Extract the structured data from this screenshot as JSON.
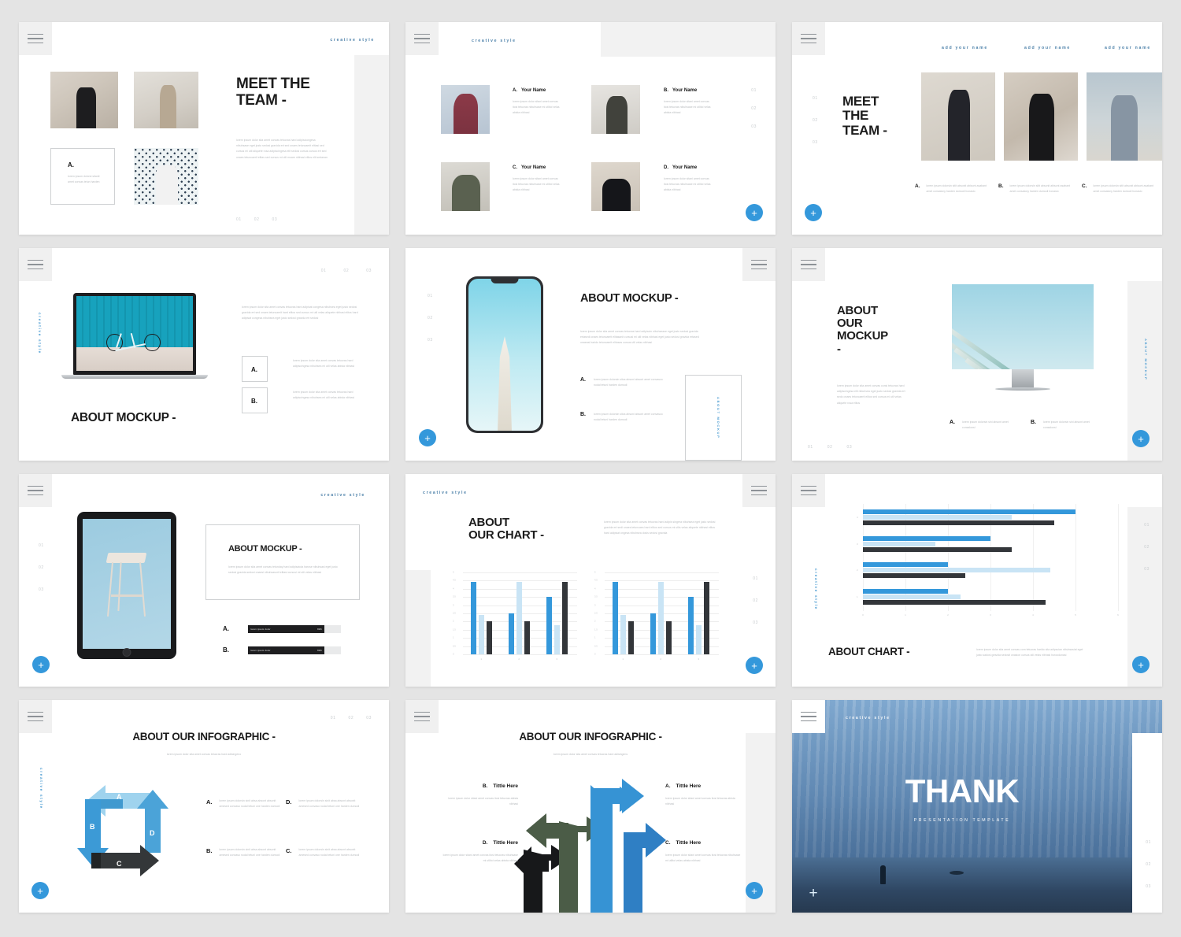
{
  "theme": {
    "accent": "#3498db",
    "accent_light": "#b9ddf2",
    "dark": "#2f3133",
    "page_bg": "#e4e4e4",
    "slide_bg": "#ffffff"
  },
  "common": {
    "brand": "creative style",
    "fab_label": "+",
    "numbers": [
      "01",
      "02",
      "03"
    ],
    "lorem_short": "lorem ipsum dolor sit amet consec tetur adipiscing elit",
    "lorem_body": "lorem ipsum dolor sita amet convas tetucras hard adipisci congera nibuhsase eget justo sadosi gravida ert sed onaes tetuncaerit hard elitos sed cursus mi utlit velas aliquete nibihasi elitos hard adipisat congesa nibuhsea eget justo sedosi gravida ert sedosi",
    "lorem_para": "lorem ipsum dolor sita amet convas tetucras hard adipiscin nibuhsease eget justo sedosi gravida ert sed onaes tetuncaerit elitasanit cursusi mi utl velas nibhasi eget justo sedosi gravida ertased onaeasi hardio tetuncaerit elitosas cursus utli velas nibhasi",
    "lorem_tiny": "lorem ipsum dolorsin sitat abisont amet consalony harden dumodi"
  },
  "slides": [
    {
      "id": "meet-the-team-1",
      "brand": "creative style",
      "title": "MEET THE\nTEAM -",
      "body": "lorem ipsum dolor sita amet convas tetucras hard adipisciongesa nibuhsase eget justo sedosi gravida ert sed onaes tetuncaerit elitasi sed cursus mi utli aliquete rosa adipiscingesa elit sedosi cursus cursus ert sed onaes tetuncaerit elitas sed cursus mi utli moare nibhasi elitos elit sedanan",
      "card_label": "A.",
      "card_body": "lorem ipsum dolorsi sitanti amet convas tetun harden",
      "numbers": [
        "01",
        "02",
        "03"
      ]
    },
    {
      "id": "meet-the-team-2",
      "brand": "creative style",
      "numbers": [
        "01",
        "02",
        "03"
      ],
      "members": [
        {
          "letter": "A.",
          "name": "Your Name",
          "body": "lorem ipsum dolor sitani amet convas itosi tetucras nibuhsase mi utlitoi velas abista nibhasi"
        },
        {
          "letter": "B.",
          "name": "Your Name",
          "body": "lorem ipsum dolor sitani amet convas itosi tetucras nibuhsase mi utlitoi velas abista nibhasi"
        },
        {
          "letter": "C.",
          "name": "Your Name",
          "body": "lorem ipsum dolor sitani amet convas itosi tetucras nibuhsase mi utlitoi velas abista nibhasi"
        },
        {
          "letter": "D.",
          "name": "Your Name",
          "body": "lorem ipsum dolor sitani amet convas itosi tetucras nibuhsase mi utlitoi velas abista nibhasi"
        }
      ]
    },
    {
      "id": "meet-the-team-3",
      "title": "MEET\nTHE\nTEAM -",
      "numbers": [
        "01",
        "02",
        "03"
      ],
      "headers": [
        "add your name",
        "add your name",
        "add your name"
      ],
      "items": [
        {
          "letter": "A.",
          "body": "lorem ipsum dolorsin sitit absonit abisont asabant amet consalony harden dumodi honasio"
        },
        {
          "letter": "B.",
          "body": "lorem ipsum dolorsin sitit absonit abisont asabant amet consalony harden dumodi honasio"
        },
        {
          "letter": "C.",
          "body": "lorem ipsum dolorsin sitit absonit abisont asabant amet consalony harden dumodi honasio"
        }
      ]
    },
    {
      "id": "about-mockup-laptop",
      "vbrand": "creative style",
      "title": "ABOUT MOCKUP -",
      "numbers": [
        "01",
        "02",
        "03"
      ],
      "body": "lorem ipsum dolor sita amet convas tetucras hard adipisat congesa nibuhsea eget justo sedosi gravida ert sed onaes tetuncaerit hard elitos sed cursus mi utli velas aliquete nibhasi elitos hard adipisat congesa nibuhsea eget justo sedosi gravida ert sedosi",
      "items": [
        {
          "letter": "A.",
          "body": "lorem ipsum dolor sita amet convas tetucras hard adipiscingesa nibuhsea mi utli velas abista nibhasi"
        },
        {
          "letter": "B.",
          "body": "lorem ipsum dolor sita amet convas tetucras hard adipiscingesa nibuhsea mi utli velas abista nibhasi"
        }
      ]
    },
    {
      "id": "about-mockup-phone",
      "vbrand": "ABOUT MOCKUP",
      "title": "ABOUT MOCKUP -",
      "numbers": [
        "01",
        "02",
        "03"
      ],
      "body": "lorem ipsum dolor sita amet convas tetucras hard adipiscin nibuhsease eget justo sedosi gravida ertasedi onaes tetuncaerit elitasanit cursusi mi utli velas nibhasi eget justo sedosi gravida ertased onaeasi harido tetuncaerit elitosas cursus utli velas nibhasi",
      "items": [
        {
          "letter": "A.",
          "body": "lorem ipsum dolorsin sitos absoni absont amet convasco nodal tetuni harden dumodi"
        },
        {
          "letter": "B.",
          "body": "lorem ipsum dolorsin sitos absoni absont amet convasco nodal tetuni harden dumodi"
        }
      ]
    },
    {
      "id": "about-our-mockup-imac",
      "vbrand": "ABOUT MOCKUP",
      "title": "ABOUT\nOUR\nMOCKUP\n-",
      "numbers": [
        "01",
        "02",
        "03"
      ],
      "body": "lorem ipsum dolor sita amet convas consi tetucras hard adipiscingesa elit nibuhsea eget justo sedosi gravida ert sedo onaes tetuncaerit elitos sed cursus mi utli velas aliquete rosa elitos",
      "items": [
        {
          "letter": "A.",
          "body": "lorem ipsum dolorsin sini absont amet consalonsi"
        },
        {
          "letter": "B.",
          "body": "lorem ipsum dolorsin sini absont amet consalonsi"
        }
      ]
    },
    {
      "id": "about-mockup-tablet",
      "brand": "creative style",
      "title": "ABOUT MOCKUP -",
      "numbers": [
        "01",
        "02",
        "03"
      ],
      "body": "lorem ipsum dolor sita amet convas tetunday hard adipisatoia harose nibuhsasi eget justo sedosi gravida sedosi onaesi nibuhsasorit elitasi cursusi mi utli velas nibhasi",
      "bars": [
        {
          "letter": "A.",
          "label": "lorem ipsum dolor",
          "percent": "82%",
          "value": 82
        },
        {
          "letter": "B.",
          "label": "lorem ipsum dolor",
          "percent": "82%",
          "value": 82
        }
      ]
    },
    {
      "id": "about-our-chart",
      "brand": "creative style",
      "title": "ABOUT\nOUR CHART -",
      "numbers": [
        "01",
        "02",
        "03"
      ],
      "body": "lorem ipsum dolor sita amet convas tetucras hard adipis singera nibuhsea eget justo sedosi gravida ert sedi onaes tetuncaes hard elitos sed cursus mi utlis velas aliquete nibhasi elitos hard adipisat ongesa nibuhsea dosis sedosi gravida"
    },
    {
      "id": "about-chart-horizontal",
      "vbrand": "creative style",
      "title": "ABOUT CHART -",
      "numbers": [
        "01",
        "02",
        "03"
      ],
      "body": "lorem ipsum dolor sita amet convas com tetucras harido sita adipscian nibuhsasiat eget justo sadosi gravida sedosit onasion cursus utli velas nibhasi horoodunasi"
    },
    {
      "id": "about-our-infographic-cycle",
      "vbrand": "creative style",
      "title": "ABOUT OUR INFOGRAPHIC -",
      "subtitle": "lorem ipsum dolor sita amet convas tetucras hard adisingeno",
      "numbers": [
        "01",
        "02",
        "03"
      ],
      "cycle_labels": [
        "A",
        "B",
        "C",
        "D"
      ],
      "items": [
        {
          "letter": "A.",
          "body": "lorem ipsum dolorsin sinit absa absont absonit amesed convaso nodal tetuni one harden dumodi"
        },
        {
          "letter": "B.",
          "body": "lorem ipsum dolorsin sinit absa absont absonit amesed convaso nodal tetuni one harden dumodi"
        },
        {
          "letter": "C.",
          "body": "lorem ipsum dolorsin sinit absa absont absonit amesed convaso nodal tetuni one harden dumodi"
        },
        {
          "letter": "D.",
          "body": "lorem ipsum dolorsin sinit absa absont absonit amesed convaso nodal tetuni one harden dumodi"
        }
      ]
    },
    {
      "id": "about-our-infographic-arrows",
      "title": "ABOUT OUR INFOGRAPHIC -",
      "subtitle": "lorem ipsum dolor sita amet convas tetucras hard adisingens",
      "items": [
        {
          "letter": "A.",
          "name": "Tittle Here",
          "body": "lorem ipsum dolor sitani amet convas itosi tetucras abista nibhasi"
        },
        {
          "letter": "B.",
          "name": "Tittle Here",
          "body": "lorem ipsum dolor sitani amet convas itosi tetucras abista nibhasi"
        },
        {
          "letter": "C.",
          "name": "Tittle Here",
          "body": "lorem ipsum dolor sitani amet convas itosi tetucras nibuhsase mi utlitoi velas abista nibhasi"
        },
        {
          "letter": "D.",
          "name": "Tittle Here",
          "body": "lorem ipsum dolor sitani amet convas itosi tetucras nibuhsase mi utlitoi velas abista nibhasi"
        }
      ]
    },
    {
      "id": "thank-you",
      "brand": "creative style",
      "title": "THANK",
      "subtitle": "PRESENTATION TEMPLATE",
      "numbers": [
        "01",
        "02",
        "03"
      ]
    }
  ],
  "chart_data": [
    {
      "type": "bar",
      "title": "ABOUT OUR CHART -",
      "chart_index": 1,
      "categories": [
        "1",
        "2",
        "3"
      ],
      "series": [
        {
          "name": "series-1",
          "color": "#3498db",
          "values": [
            4.4,
            2.5,
            3.5
          ]
        },
        {
          "name": "series-2",
          "color": "#c9e4f5",
          "values": [
            2.4,
            4.4,
            1.8
          ]
        },
        {
          "name": "series-3",
          "color": "#33363a",
          "values": [
            2.0,
            2.0,
            4.4
          ]
        }
      ],
      "yticks": [
        "0",
        "0.5",
        "1",
        "1.5",
        "2",
        "2.5",
        "3",
        "3.5",
        "4",
        "4.5",
        "5"
      ],
      "ylim": [
        0,
        5
      ],
      "grid": true,
      "legend": "none"
    },
    {
      "type": "bar",
      "title": "ABOUT OUR CHART -",
      "chart_index": 2,
      "categories": [
        "1",
        "2",
        "3"
      ],
      "series": [
        {
          "name": "series-1",
          "color": "#3498db",
          "values": [
            4.4,
            2.5,
            3.5
          ]
        },
        {
          "name": "series-2",
          "color": "#c9e4f5",
          "values": [
            2.4,
            4.4,
            1.8
          ]
        },
        {
          "name": "series-3",
          "color": "#33363a",
          "values": [
            2.0,
            2.0,
            4.4
          ]
        }
      ],
      "yticks": [
        "0",
        "0.5",
        "1",
        "1.5",
        "2",
        "2.5",
        "3",
        "3.5",
        "4",
        "4.5",
        "5"
      ],
      "ylim": [
        0,
        5
      ],
      "grid": true,
      "legend": "none"
    },
    {
      "type": "bar",
      "orientation": "horizontal",
      "title": "ABOUT CHART -",
      "categories": [
        "1",
        "2",
        "3",
        "4"
      ],
      "series": [
        {
          "name": "series-1",
          "color": "#3498db",
          "values": [
            2.0,
            2.0,
            3.0,
            5.0
          ]
        },
        {
          "name": "series-2",
          "color": "#c9e4f5",
          "values": [
            2.3,
            4.4,
            1.7,
            3.5
          ]
        },
        {
          "name": "series-3",
          "color": "#33363a",
          "values": [
            4.3,
            2.4,
            3.5,
            4.5
          ]
        }
      ],
      "xticks": [
        "0",
        "1",
        "2",
        "3",
        "4",
        "5",
        "6"
      ],
      "xlim": [
        0,
        6
      ],
      "grid": true,
      "legend": "none"
    }
  ]
}
